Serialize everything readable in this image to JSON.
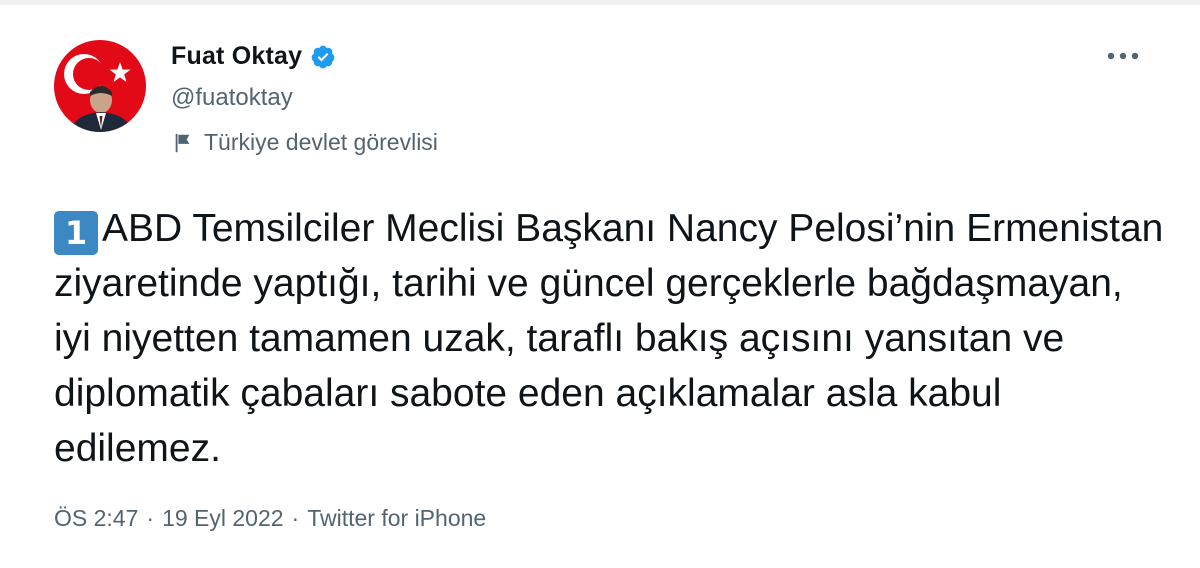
{
  "author": {
    "display_name": "Fuat Oktay",
    "handle": "@fuatoktay",
    "label": "Türkiye devlet görevlisi",
    "verified": true
  },
  "tweet": {
    "number_badge": "1",
    "text": "ABD Temsilciler Meclisi Başkanı Nancy Pelosi’nin Ermenistan ziyaretinde yaptığı, tarihi ve güncel gerçeklerle bağdaşmayan, iyi niyetten tamamen uzak, taraflı bakış açısını yansıtan ve diplomatik çabaları sabote eden açıklamalar asla kabul edilemez."
  },
  "meta": {
    "time": "ÖS 2:47",
    "separator1": "·",
    "date": "19 Eyl 2022",
    "separator2": "·",
    "source": "Twitter for iPhone"
  },
  "icons": {
    "verified": "verified-badge-icon",
    "label": "flag-icon",
    "more": "more-horizontal-icon",
    "number_badge": "keycap-1-emoji"
  },
  "colors": {
    "text_primary": "#0f1419",
    "text_secondary": "#536471",
    "verified_blue": "#1d9bf0",
    "keycap_blue": "#3b88c3",
    "avatar_red": "#e30a17"
  }
}
